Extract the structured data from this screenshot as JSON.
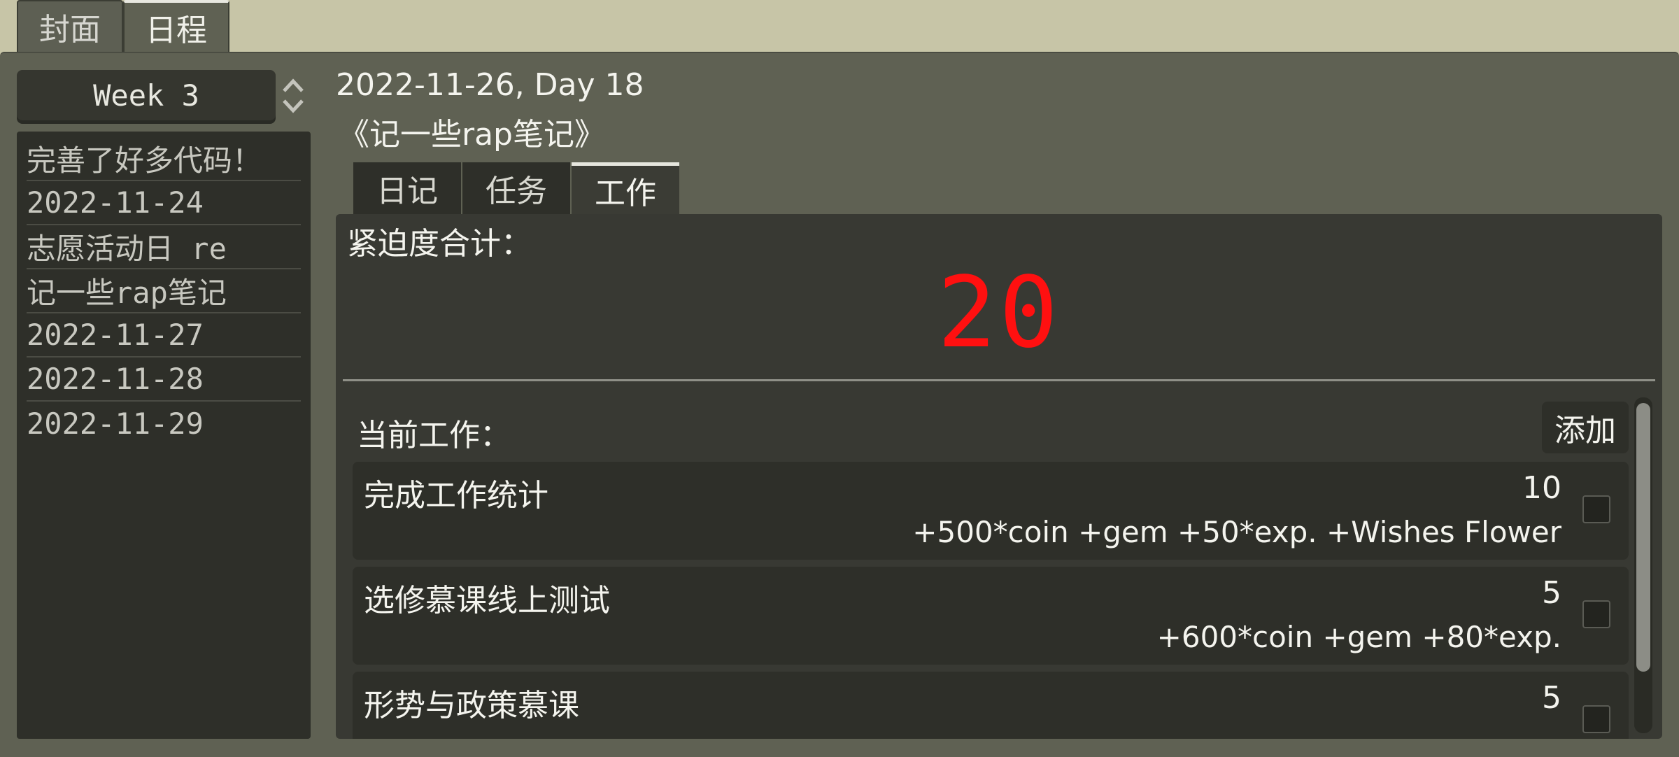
{
  "top_tabs": [
    "封面",
    "日程"
  ],
  "active_top_tab": 1,
  "week": {
    "label": "Week 3"
  },
  "days": [
    "完善了好多代码！",
    "2022-11-24",
    "志愿活动日 re",
    "记一些rap笔记",
    "2022-11-27",
    "2022-11-28",
    "2022-11-29"
  ],
  "header": {
    "date": "2022-11-26, Day 18",
    "title": "《记一些rap笔记》"
  },
  "inner_tabs": [
    "日记",
    "任务",
    "工作"
  ],
  "active_inner_tab": 2,
  "urgency": {
    "label": "紧迫度合计：",
    "total": "20",
    "total_color": "#ff1010"
  },
  "current_work": {
    "label": "当前工作：",
    "add_label": "添加"
  },
  "works": [
    {
      "name": "完成工作统计",
      "urgency": "10",
      "rewards": "+500*coin +gem +50*exp. +Wishes Flower",
      "done": false
    },
    {
      "name": "选修慕课线上测试",
      "urgency": "5",
      "rewards": "+600*coin +gem +80*exp.",
      "done": false
    },
    {
      "name": "形势与政策慕课",
      "urgency": "5",
      "rewards": "",
      "done": false
    }
  ],
  "icons": {
    "week_spinner": "up-down-chevron-icon",
    "checkbox": "checkbox-icon"
  }
}
